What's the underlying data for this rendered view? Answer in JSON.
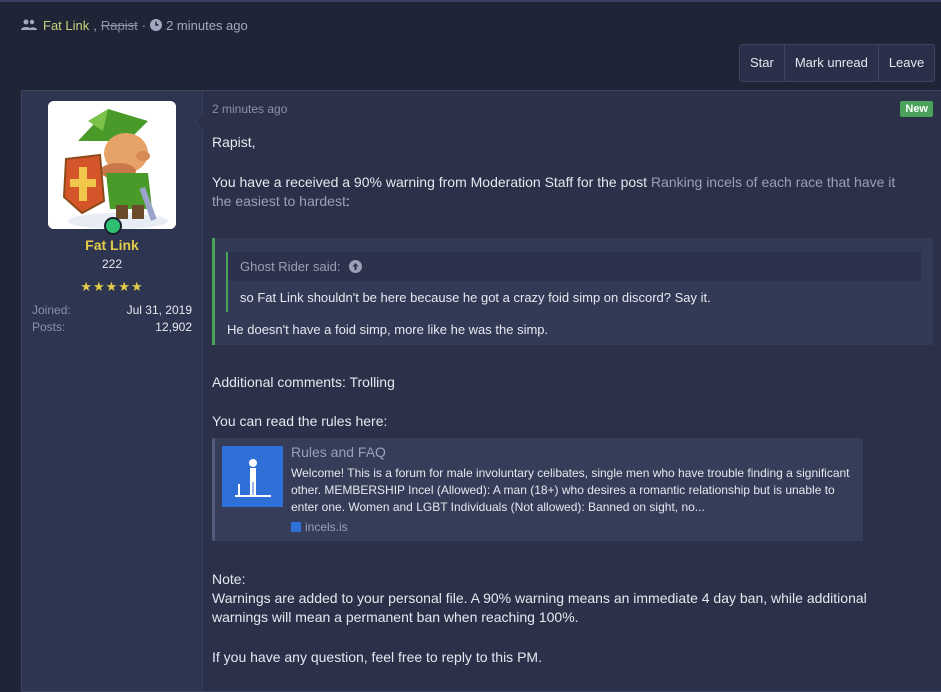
{
  "header": {
    "participant_primary": "Fat Link",
    "participant_separator": ",",
    "participant_removed": "Rapist",
    "dot": "·",
    "time": "2 minutes ago"
  },
  "actions": {
    "star": "Star",
    "mark_unread": "Mark unread",
    "leave": "Leave"
  },
  "user": {
    "name": "Fat Link",
    "title": "222",
    "stars": "★★★★★",
    "joined_label": "Joined:",
    "joined_value": "Jul 31, 2019",
    "posts_label": "Posts:",
    "posts_value": "12,902"
  },
  "message": {
    "timestamp": "2 minutes ago",
    "badge": "New",
    "greeting": "Rapist,",
    "warning_line1": "You have a received a 90% warning from Moderation Staff for the post ",
    "warning_link_part1": "Ranking incels of each race that have it",
    "warning_link_part2": "the easiest to hardest",
    "warning_colon": ":",
    "quote": {
      "attribution": "Ghost Rider said:",
      "inner_text": "so Fat Link shouldn't be here because he got a crazy foid simp on discord? Say it.",
      "reply": "He doesn't have a foid simp, more like he was the simp."
    },
    "additional": "Additional comments: Trolling",
    "rules_intro": "You can read the rules here:",
    "embed": {
      "title": "Rules and FAQ",
      "description": "Welcome! This is a forum for male involuntary celibates, single men who have trouble finding a significant other. MEMBERSHIP Incel (Allowed): A man (18+) who desires a romantic relationship but is unable to enter one. Women and LGBT Individuals (Not allowed): Banned on sight, no...",
      "domain": "incels.is"
    },
    "note_label": "Note:",
    "note_line1": "Warnings are added to your personal file. A 90% warning means an immediate 4 day ban, while additional",
    "note_line2": "warnings will mean a permanent ban when reaching 100%.",
    "closing": "If you have any question, feel free to reply to this PM."
  },
  "colors": {
    "background": "#1f2437",
    "username": "#e3cc4a",
    "new_badge": "#4aa35b",
    "quote_border": "#4aa35b",
    "online": "#2fbf71"
  }
}
